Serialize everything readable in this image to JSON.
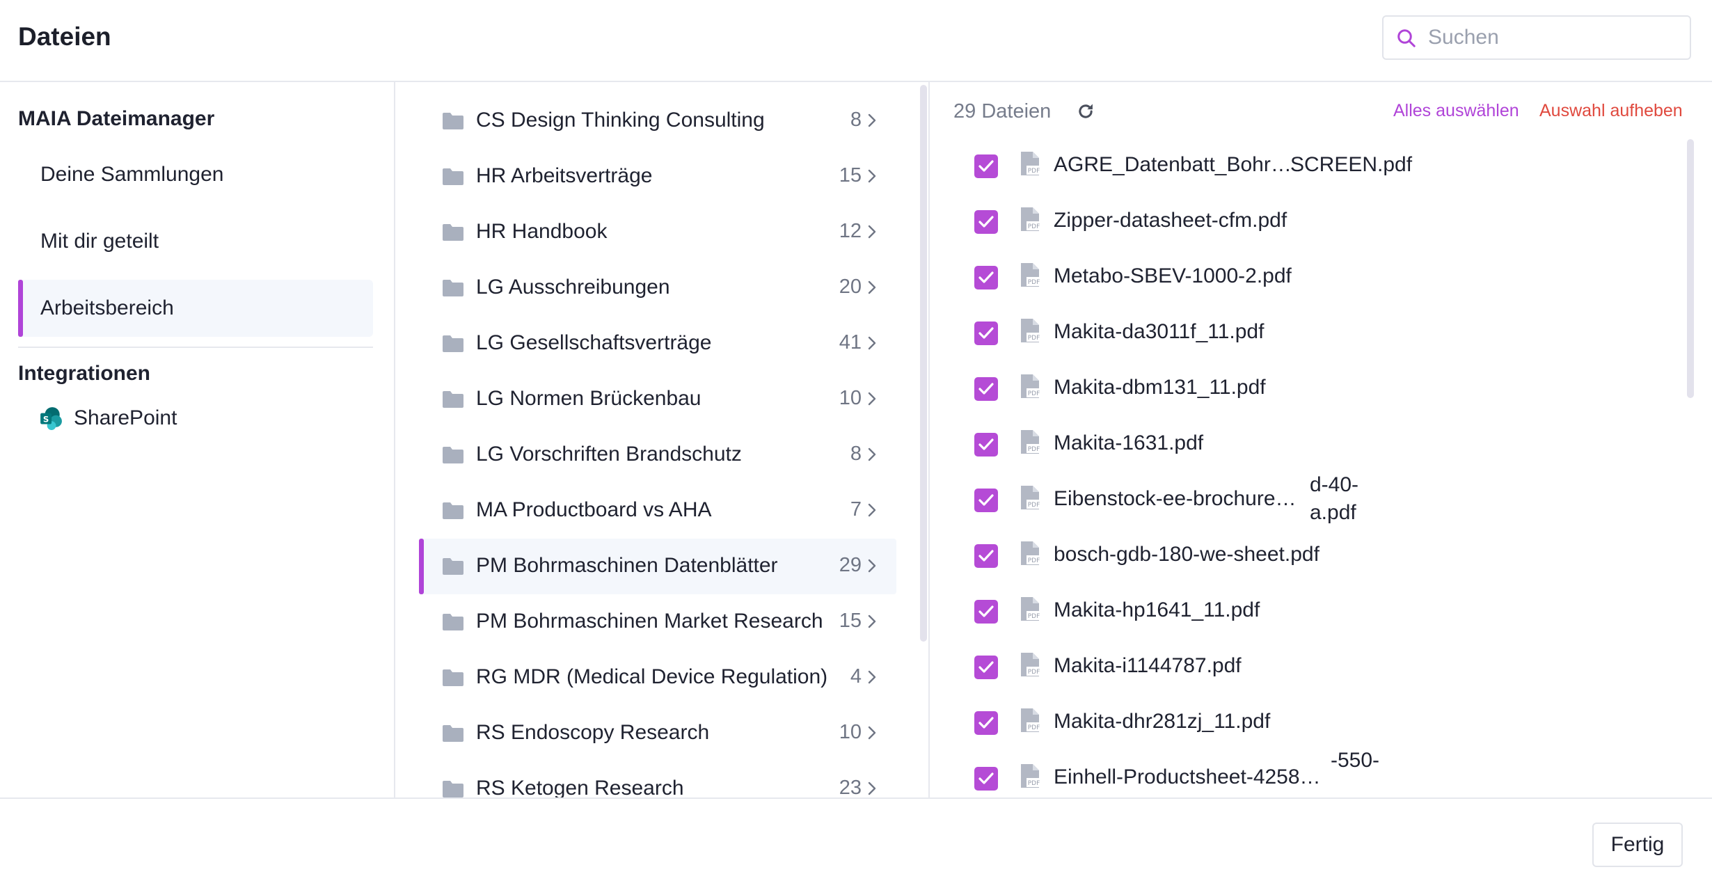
{
  "header": {
    "title": "Dateien",
    "search_placeholder": "Suchen"
  },
  "sidebar": {
    "section_title": "MAIA Dateimanager",
    "items": [
      {
        "label": "Deine Sammlungen",
        "active": false
      },
      {
        "label": "Mit dir geteilt",
        "active": false
      },
      {
        "label": "Arbeitsbereich",
        "active": true
      }
    ],
    "integrations_title": "Integrationen",
    "integrations": [
      {
        "label": "SharePoint",
        "icon": "sharepoint-icon"
      }
    ]
  },
  "folders": [
    {
      "name": "CS Design Thinking Consulting",
      "count": "8"
    },
    {
      "name": "HR Arbeitsverträge",
      "count": "15"
    },
    {
      "name": "HR Handbook",
      "count": "12"
    },
    {
      "name": "LG Ausschreibungen",
      "count": "20"
    },
    {
      "name": "LG Gesellschaftsverträge",
      "count": "41"
    },
    {
      "name": "LG Normen Brückenbau",
      "count": "10"
    },
    {
      "name": "LG Vorschriften Brandschutz",
      "count": "8"
    },
    {
      "name": "MA Productboard vs AHA",
      "count": "7"
    },
    {
      "name": "PM Bohrmaschinen Datenblätter",
      "count": "29",
      "active": true
    },
    {
      "name": "PM Bohrmaschinen Market Research",
      "count": "15"
    },
    {
      "name": "RG MDR (Medical Device Regulation)",
      "count": "4"
    },
    {
      "name": "RS Endoscopy Research",
      "count": "10"
    },
    {
      "name": "RS Ketogen Research",
      "count": "23"
    }
  ],
  "files_panel": {
    "count_label": "29 Dateien",
    "select_all": "Alles auswählen",
    "deselect_all": "Auswahl aufheben",
    "accent_color": "#b044d8",
    "danger_color": "#e0493e",
    "files": [
      {
        "name": "AGRE_Datenbatt_Bohr…",
        "suffix": "SCREEN.pdf",
        "checked": true
      },
      {
        "name": "Zipper-datasheet-cfm.pdf",
        "checked": true
      },
      {
        "name": "Metabo-SBEV-1000-2.pdf",
        "checked": true
      },
      {
        "name": "Makita-da3011f_11.pdf",
        "checked": true
      },
      {
        "name": "Makita-dbm131_11.pdf",
        "checked": true
      },
      {
        "name": "Makita-1631.pdf",
        "checked": true
      },
      {
        "name": "Eibenstock-ee-brochure…",
        "suffix": "d-40-",
        "suffix2": "a.pdf",
        "checked": true
      },
      {
        "name": "bosch-gdb-180-we-sheet.pdf",
        "checked": true
      },
      {
        "name": "Makita-hp1641_11.pdf",
        "checked": true
      },
      {
        "name": "Makita-i1144787.pdf",
        "checked": true
      },
      {
        "name": "Makita-dhr281zj_11.pdf",
        "checked": true
      },
      {
        "name": "Einhell-Productsheet-4258…",
        "suffix": "-550-",
        "checked": true
      }
    ]
  },
  "footer": {
    "done_label": "Fertig"
  }
}
